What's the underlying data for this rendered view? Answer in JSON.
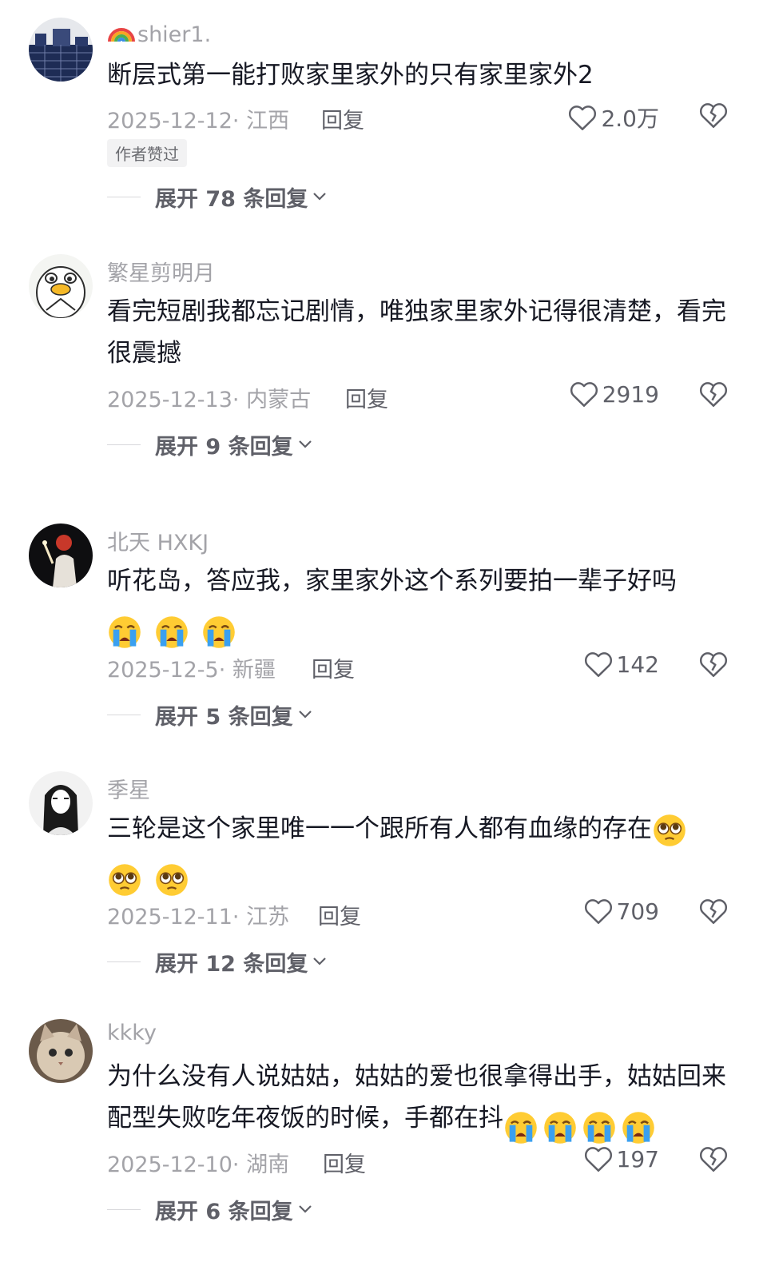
{
  "comments": [
    {
      "username": "shier1.",
      "content": "断层式第一能打败家里家外的只有家里家外2",
      "date": "2025-12-12· 江西",
      "reply": "回复",
      "likes": "2.0万",
      "badge": "作者赞过",
      "expand": "展开 78 条回复",
      "avatar_icon": "blue-building-avatar"
    },
    {
      "username": "繁星剪明月",
      "content": "看完短剧我都忘记剧情，唯独家里家外记得很清楚，看完很震撼",
      "date": "2025-12-13· 内蒙古",
      "reply": "回复",
      "likes": "2919",
      "expand": "展开 9 条回复",
      "avatar_icon": "duck-avatar"
    },
    {
      "username": "北天 HXKJ",
      "content": "听花岛，答应我，家里家外这个系列要拍一辈子好吗",
      "emoji_count": 3,
      "emoji": "crying-face",
      "date": "2025-12-5· 新疆",
      "reply": "回复",
      "likes": "142",
      "expand": "展开 5 条回复",
      "avatar_icon": "dark-photo-avatar"
    },
    {
      "username": "季星",
      "content": "三轮是这个家里唯一一个跟所有人都有血缘的存在",
      "emoji_count": 3,
      "emoji": "pleading-face",
      "date": "2025-12-11· 江苏",
      "reply": "回复",
      "likes": "709",
      "expand": "展开 12 条回复",
      "avatar_icon": "manga-girl-avatar"
    },
    {
      "username": "kkky",
      "content": "为什么没有人说姑姑，姑姑的爱也很拿得出手，姑姑回来配型失败吃年夜饭的时候，手都在抖",
      "emoji_count": 4,
      "emoji": "crying-face",
      "date": "2025-12-10· 湖南",
      "reply": "回复",
      "likes": "197",
      "expand": "展开 6 条回复",
      "avatar_icon": "cat-avatar"
    }
  ],
  "colors": {
    "text": "#161823",
    "muted": "#a3a3a8",
    "action": "#5f6068"
  }
}
